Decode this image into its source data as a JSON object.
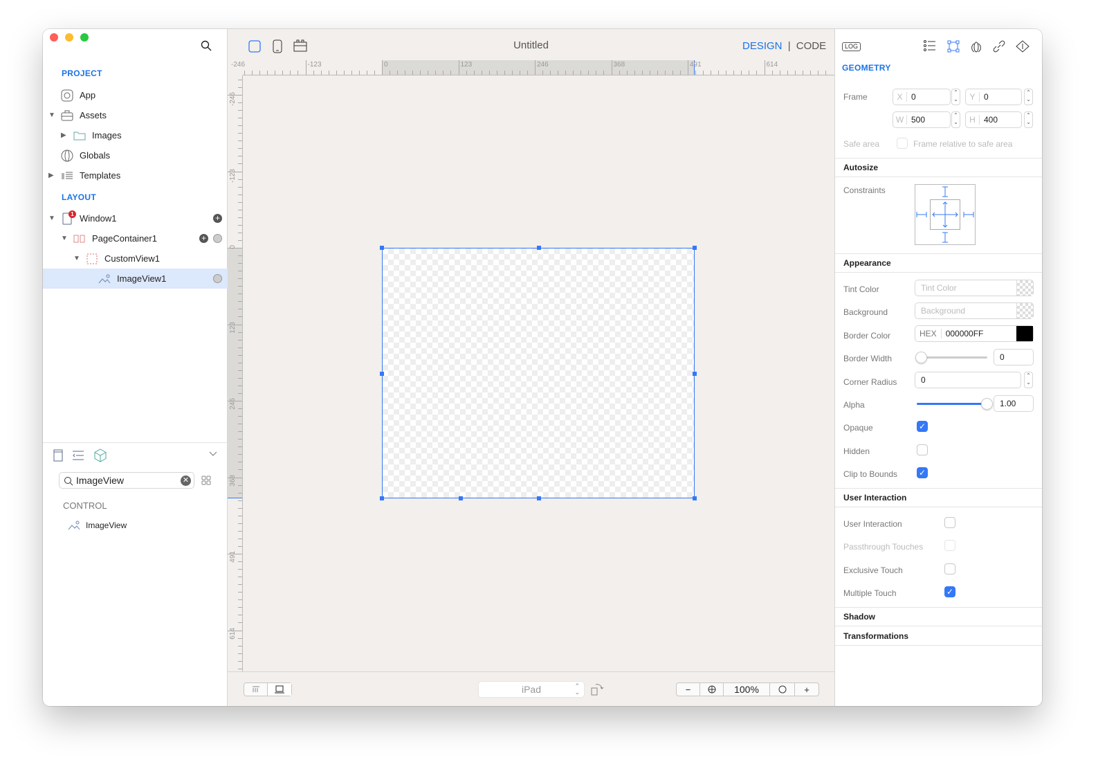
{
  "window": {
    "title": "Untitled"
  },
  "sidebar": {
    "project_label": "PROJECT",
    "project_items": [
      {
        "label": "App",
        "icon": "app-icon"
      },
      {
        "label": "Assets",
        "icon": "briefcase-icon",
        "expanded": true
      },
      {
        "label": "Images",
        "icon": "folder-icon",
        "expanded": false
      },
      {
        "label": "Globals",
        "icon": "globe-icon"
      },
      {
        "label": "Templates",
        "icon": "templates-icon",
        "expanded": false
      }
    ],
    "layout_label": "LAYOUT",
    "layout_items": [
      {
        "label": "Window1",
        "badge": "1"
      },
      {
        "label": "PageContainer1"
      },
      {
        "label": "CustomView1"
      },
      {
        "label": "ImageView1",
        "selected": true
      }
    ],
    "library": {
      "search_value": "ImageView",
      "category": "CONTROL",
      "results": [
        "ImageView"
      ]
    }
  },
  "toolbar": {
    "design_label": "DESIGN",
    "separator": "|",
    "code_label": "CODE"
  },
  "ruler": {
    "h_labels": [
      "-246",
      "-123",
      "0",
      "123",
      "246",
      "368",
      "491",
      "614"
    ],
    "v_labels": [
      "-246",
      "-123",
      "0",
      "123",
      "246",
      "368",
      "491",
      "614"
    ]
  },
  "bottom": {
    "device": "iPad",
    "zoom": "100%",
    "zoom_out": "−",
    "zoom_in": "+"
  },
  "inspector": {
    "log_label": "LOG",
    "geometry_label": "GEOMETRY",
    "frame_label": "Frame",
    "x_label": "X",
    "x": "0",
    "y_label": "Y",
    "y": "0",
    "w_label": "W",
    "w": "500",
    "h_label": "H",
    "h": "400",
    "safe_area_label": "Safe area",
    "safe_area_checkbox": "Frame relative to safe area",
    "autosize_label": "Autosize",
    "constraints_label": "Constraints",
    "appearance_label": "Appearance",
    "tint_label": "Tint Color",
    "tint_placeholder": "Tint Color",
    "background_label": "Background",
    "background_placeholder": "Background",
    "border_color_label": "Border Color",
    "hex_label": "HEX",
    "border_color": "000000FF",
    "border_color_hex": "#000000",
    "border_width_label": "Border Width",
    "border_width": "0",
    "border_width_fraction": 0,
    "corner_radius_label": "Corner Radius",
    "corner_radius": "0",
    "alpha_label": "Alpha",
    "alpha": "1.00",
    "alpha_fraction": 1.0,
    "opaque_label": "Opaque",
    "opaque": true,
    "hidden_label": "Hidden",
    "hidden": false,
    "clip_label": "Clip to Bounds",
    "clip": true,
    "user_interaction_header": "User Interaction",
    "user_interaction_label": "User Interaction",
    "user_interaction": false,
    "passthrough_label": "Passthrough Touches",
    "passthrough": false,
    "exclusive_label": "Exclusive Touch",
    "exclusive": false,
    "multiple_label": "Multiple Touch",
    "multiple": true,
    "shadow_label": "Shadow",
    "transformations_label": "Transformations"
  },
  "colors": {
    "accent": "#1a73e8",
    "selection": "#3478f6",
    "row_selected": "#dce8fb"
  }
}
